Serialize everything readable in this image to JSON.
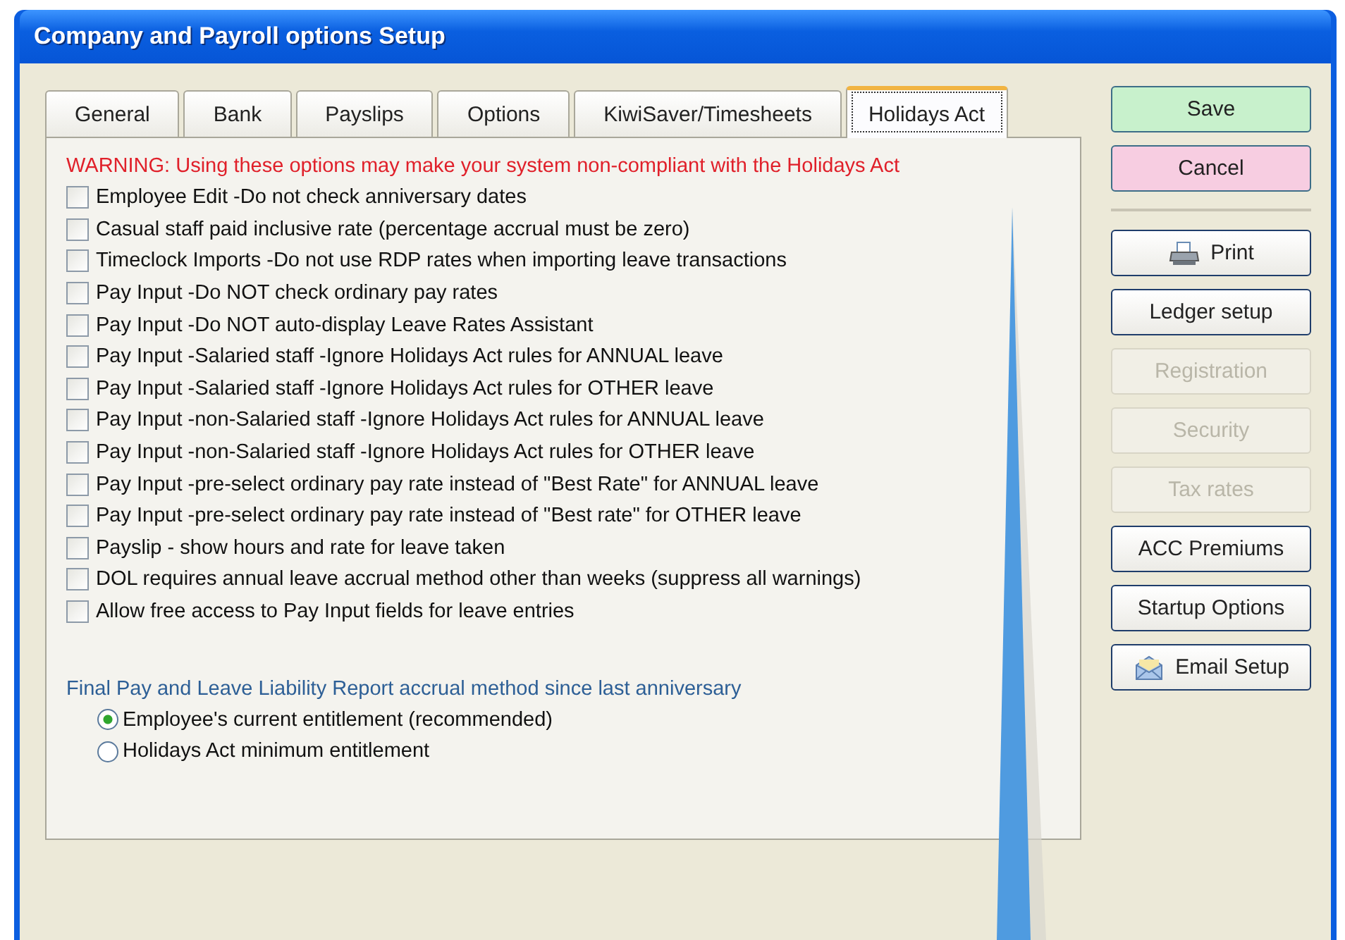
{
  "window": {
    "title": "Company and Payroll options Setup"
  },
  "tabs": [
    {
      "label": "General",
      "selected": false
    },
    {
      "label": "Bank",
      "selected": false
    },
    {
      "label": "Payslips",
      "selected": false
    },
    {
      "label": "Options",
      "selected": false
    },
    {
      "label": "KiwiSaver/Timesheets",
      "selected": false
    },
    {
      "label": "Holidays Act",
      "selected": true
    }
  ],
  "warning": "WARNING: Using these options may make your system non-compliant with the Holidays Act",
  "options": [
    {
      "label": "Employee Edit -Do not check anniversary dates",
      "checked": false
    },
    {
      "label": "Casual staff paid inclusive rate (percentage accrual must be zero)",
      "checked": false
    },
    {
      "label": "Timeclock Imports -Do not use RDP rates when importing leave transactions",
      "checked": false
    },
    {
      "label": "Pay Input -Do NOT check ordinary pay rates",
      "checked": false
    },
    {
      "label": "Pay Input -Do NOT auto-display Leave Rates Assistant",
      "checked": false
    },
    {
      "label": "Pay Input -Salaried staff -Ignore Holidays Act rules for ANNUAL leave",
      "checked": false
    },
    {
      "label": "Pay Input -Salaried staff -Ignore Holidays Act rules for OTHER leave",
      "checked": false
    },
    {
      "label": "Pay Input -non-Salaried staff -Ignore Holidays Act rules for ANNUAL leave",
      "checked": false
    },
    {
      "label": "Pay Input -non-Salaried staff -Ignore Holidays Act rules for OTHER leave",
      "checked": false
    },
    {
      "label": "Pay Input -pre-select ordinary pay rate instead of \"Best Rate\" for ANNUAL leave",
      "checked": false
    },
    {
      "label": "Pay Input -pre-select ordinary pay rate instead of \"Best rate\" for OTHER leave",
      "checked": false
    },
    {
      "label": "Payslip - show hours and rate for leave taken",
      "checked": false
    },
    {
      "label": "DOL requires annual leave accrual method other than weeks (suppress all warnings)",
      "checked": false
    },
    {
      "label": "Allow free access to Pay Input fields for leave entries",
      "checked": false
    }
  ],
  "accrual_method": {
    "heading": "Final Pay and Leave Liability Report accrual method since last anniversary",
    "choices": [
      {
        "label": "Employee's current entitlement (recommended)",
        "selected": true
      },
      {
        "label": "Holidays Act minimum entitlement",
        "selected": false
      }
    ]
  },
  "actions": [
    {
      "label": "Save",
      "color": "#c8f1cc"
    },
    {
      "label": "Cancel",
      "color": "#f7cde1"
    }
  ],
  "buttons": [
    {
      "label": "Print",
      "kind": "printer",
      "disabled": false
    },
    {
      "label": "Ledger setup",
      "kind": "plain",
      "disabled": false
    },
    {
      "label": "Registration",
      "kind": "plain",
      "disabled": true
    },
    {
      "label": "Security",
      "kind": "plain",
      "disabled": true
    },
    {
      "label": "Tax rates",
      "kind": "plain",
      "disabled": true
    },
    {
      "label": "ACC Premiums",
      "kind": "plain",
      "disabled": false
    },
    {
      "label": "Startup Options",
      "kind": "plain",
      "disabled": false
    },
    {
      "label": "Email Setup",
      "kind": "mail",
      "disabled": false
    }
  ]
}
